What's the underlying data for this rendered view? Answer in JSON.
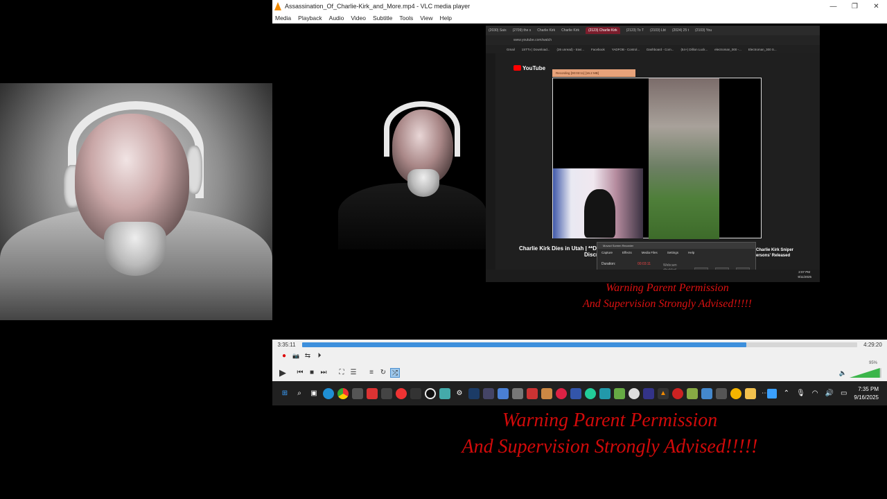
{
  "window": {
    "title": "Assassination_Of_Charlie-Kirk_and_More.mp4 - VLC media player",
    "minimize_glyph": "—",
    "restore_glyph": "❐",
    "close_glyph": "✕"
  },
  "menu": [
    "Media",
    "Playback",
    "Audio",
    "Video",
    "Subtitle",
    "Tools",
    "View",
    "Help"
  ],
  "browser": {
    "tabs": [
      "(2030) Sais",
      "(2709) the s",
      "Charlie Kirk",
      "Charlie Kirk",
      "(2123) Charlie Kirk",
      "(2123) To T",
      "(2103) Lbt",
      "(2024) 25 t",
      "(2103) You"
    ],
    "active_tab_index": 4,
    "url": "www.youtube.com/watch",
    "bookmarks": [
      "Gmail",
      "1STTv | Download...",
      "(26 unread) - travi...",
      "Facebook",
      "YADFOB - Control...",
      "Dashboard - Com...",
      "(54+) Dillion Luck...",
      "electroman_000 -...",
      "Electroman_300 S..."
    ],
    "youtube_label": "YouTube",
    "recording_bar": "Recording [00:03:11] [16.2 MB]",
    "video_title_left": "Charlie Kirk Dies in Utah | **Delete",
    "video_title_left2": "Discre",
    "video_title_right": "Charlie Kirk Sniper",
    "video_title_right2": "ersons' Released",
    "recorder": {
      "title": "Movavi Screen Recorder",
      "menu": [
        "Capture",
        "Effects",
        "Media Files",
        "Settings",
        "Help"
      ],
      "duration_label": "Duration:",
      "duration_value": "00:03:11",
      "webcam": "Webcam disabled"
    },
    "inner_clock_time": "2:07 PM",
    "inner_clock_date": "9/11/2025"
  },
  "warning_small": {
    "line1": "Warning Parent Permission",
    "line2": "And Supervision Strongly Advised!!!!!"
  },
  "controls": {
    "elapsed": "3:35:11",
    "total": "4:29:20",
    "progress": 0.8,
    "volume_percent": "95%",
    "volume_level": 0.95,
    "record_glyph": "●",
    "snapshot_glyph": "📷",
    "loop_ab_glyph": "⇆",
    "frame_glyph": "⏵",
    "play_glyph": "▶",
    "prev_glyph": "⏮",
    "stop_glyph": "■",
    "next_glyph": "⏭",
    "fullscreen_glyph": "⛶",
    "ext_glyph": "☰",
    "playlist_glyph": "≡",
    "loop_glyph": "↻",
    "shuffle_glyph": "⤮",
    "volume_glyph": "🔈"
  },
  "taskbar": {
    "time": "7:35 PM",
    "date": "9/16/2025"
  },
  "warning_big": {
    "line1": "Warning Parent Permission",
    "line2": "And Supervision Strongly Advised!!!!!"
  },
  "colors": {
    "warning_red": "#d10a0a",
    "seek_blue": "#3d8fdc",
    "volume_green": "#3bb54a",
    "vlc_orange": "#f18a00"
  }
}
